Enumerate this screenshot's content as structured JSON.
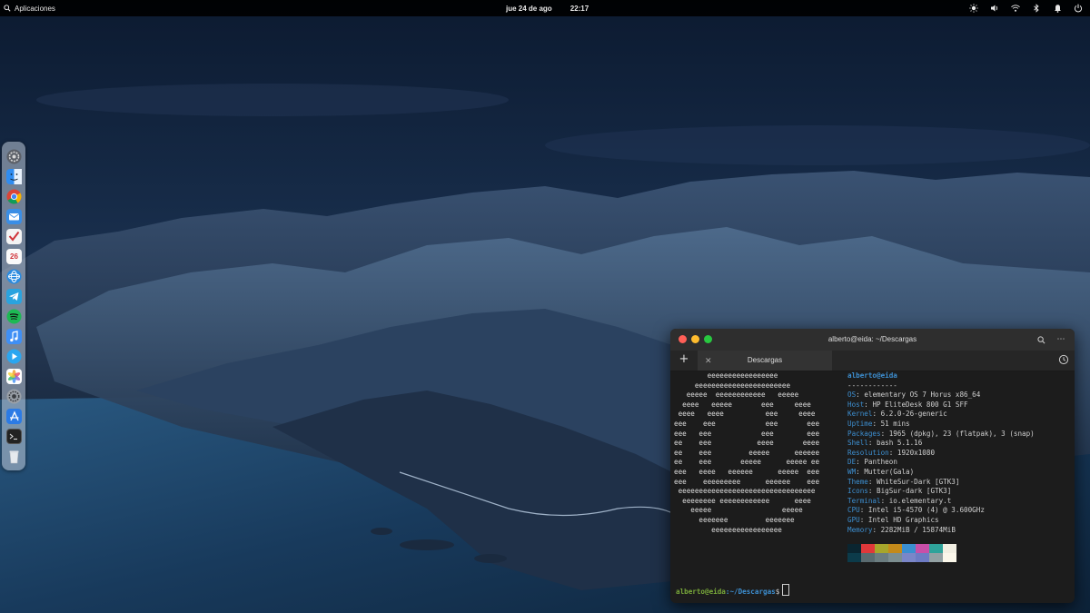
{
  "panel": {
    "applications_label": "Aplicaciones",
    "date": "jue 24 de ago",
    "time": "22:17",
    "indicators": [
      "brightness-icon",
      "volume-icon",
      "wifi-icon",
      "bluetooth-icon",
      "notifications-icon",
      "power-icon"
    ]
  },
  "dock": {
    "items": [
      {
        "name": "system-settings",
        "color": "#8a8f98"
      },
      {
        "name": "finder",
        "color": "#2f8cf0"
      },
      {
        "name": "chrome",
        "color": "#e8e8e8"
      },
      {
        "name": "mail",
        "color": "#3a8ee6"
      },
      {
        "name": "tasks",
        "color": "#f4f4f4"
      },
      {
        "name": "calendar",
        "color": "#f8f8f8",
        "label": "26"
      },
      {
        "name": "web-browser",
        "color": "#2a8be0"
      },
      {
        "name": "telegram",
        "color": "#2aa3df"
      },
      {
        "name": "spotify",
        "color": "#1db954"
      },
      {
        "name": "music",
        "color": "#3f8ff5"
      },
      {
        "name": "videos",
        "color": "#2aa6f0"
      },
      {
        "name": "photos",
        "color": "#f0a030"
      },
      {
        "name": "settings",
        "color": "#9aa0a8"
      },
      {
        "name": "app-store",
        "color": "#2c7be5"
      },
      {
        "name": "terminal",
        "color": "#2a2a2a"
      },
      {
        "name": "trash",
        "color": "#e6eaee"
      }
    ]
  },
  "terminal": {
    "title": "alberto@eida: ~/Descargas",
    "tab_label": "Descargas",
    "logo_lines": [
      "        eeeeeeeeeeeeeeeee",
      "     eeeeeeeeeeeeeeeeeeeeeee",
      "   eeeee  eeeeeeeeeeee   eeeee",
      "  eeee   eeeee       eee     eeee",
      " eeee   eeee          eee     eeee",
      "eee    eee            eee       eee",
      "eee   eee            eee        eee",
      "ee    eee           eeee       eeee",
      "ee    eee         eeeee      eeeeee",
      "ee    eee       eeeee      eeeee ee",
      "eee   eeee   eeeeee      eeeee  eee",
      "eee    eeeeeeeee      eeeeee    eee",
      " eeeeeeeeeeeeeeeeeeeeeeeeeeeeeeeee",
      "  eeeeeeee eeeeeeeeeeee      eeee",
      "    eeeee                 eeeee",
      "      eeeeeee         eeeeeee",
      "         eeeeeeeeeeeeeeeee"
    ],
    "user_host": "alberto@eida",
    "separator": "------------",
    "info": [
      {
        "key": "OS",
        "value": "elementary OS 7 Horus x86_64"
      },
      {
        "key": "Host",
        "value": "HP EliteDesk 800 G1 SFF"
      },
      {
        "key": "Kernel",
        "value": "6.2.0-26-generic"
      },
      {
        "key": "Uptime",
        "value": "51 mins"
      },
      {
        "key": "Packages",
        "value": "1965 (dpkg), 23 (flatpak), 3 (snap)"
      },
      {
        "key": "Shell",
        "value": "bash 5.1.16"
      },
      {
        "key": "Resolution",
        "value": "1920x1080"
      },
      {
        "key": "DE",
        "value": "Pantheon"
      },
      {
        "key": "WM",
        "value": "Mutter(Gala)"
      },
      {
        "key": "Theme",
        "value": "WhiteSur-Dark [GTK3]"
      },
      {
        "key": "Icons",
        "value": "BigSur-dark [GTK3]"
      },
      {
        "key": "Terminal",
        "value": "io.elementary.t"
      },
      {
        "key": "CPU",
        "value": "Intel i5-4570 (4) @ 3.600GHz"
      },
      {
        "key": "GPU",
        "value": "Intel HD Graphics"
      },
      {
        "key": "Memory",
        "value": "2282MiB / 15874MiB"
      }
    ],
    "palette_top": [
      "#0a2530",
      "#e0383a",
      "#a6a62b",
      "#c48a1a",
      "#3b8fd0",
      "#c84fa8",
      "#2fa39a",
      "#f2efe2"
    ],
    "palette_bottom": [
      "#0c3b4a",
      "#5a6b70",
      "#6b7d80",
      "#7c8e90",
      "#7a86c8",
      "#6d7bc4",
      "#93a1a3",
      "#fbf7ea"
    ],
    "prompt_user": "alberto@eida",
    "prompt_path": ":~/Descargas",
    "prompt_symbol": "$"
  }
}
